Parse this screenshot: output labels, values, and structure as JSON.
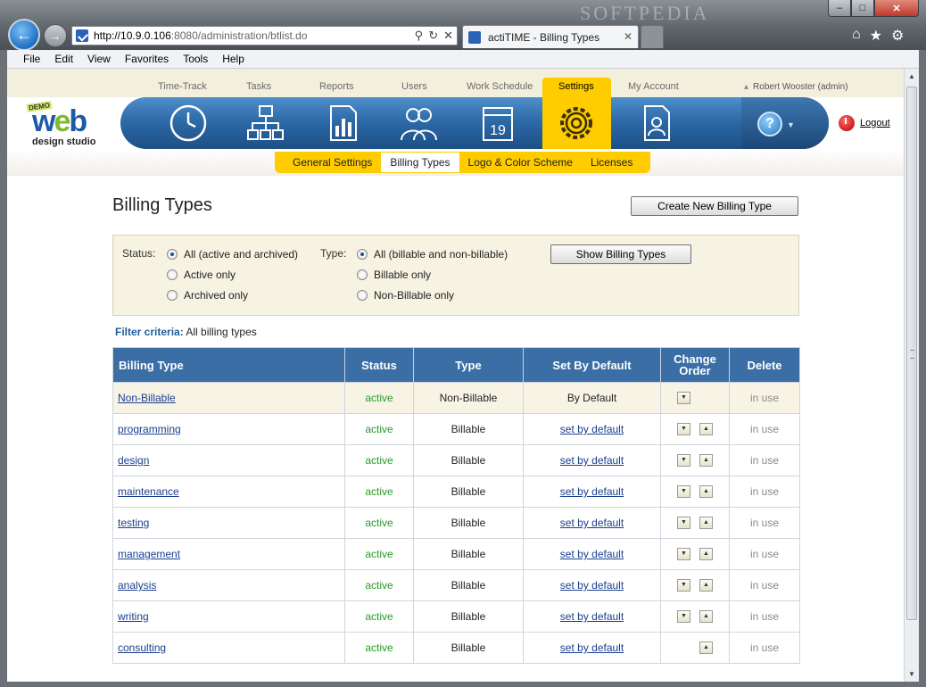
{
  "browser": {
    "url_host": "http://10.9.0.106",
    "url_rest": ":8080/administration/btlist.do",
    "tab_title": "actiTIME - Billing Types",
    "watermark": "SOFTPEDIA",
    "menu": [
      "File",
      "Edit",
      "View",
      "Favorites",
      "Tools",
      "Help"
    ]
  },
  "app": {
    "nav": [
      "Time-Track",
      "Tasks",
      "Reports",
      "Users",
      "Work Schedule",
      "Settings",
      "My Account"
    ],
    "user": "Robert Wooster (admin)",
    "logout": "Logout",
    "logo": {
      "demo": "DEMO",
      "web_w": "w",
      "web_e": "e",
      "web_b": "b",
      "sub": "design studio"
    },
    "subtabs": [
      "General Settings",
      "Billing Types",
      "Logo & Color Scheme",
      "Licenses"
    ],
    "help_icon_glyph": "?"
  },
  "page": {
    "title": "Billing Types",
    "create_button": "Create New Billing Type",
    "show_button": "Show Billing Types",
    "status_label": "Status:",
    "type_label": "Type:",
    "status_options": [
      "All (active and archived)",
      "Active only",
      "Archived only"
    ],
    "type_options": [
      "All (billable and non-billable)",
      "Billable only",
      "Non-Billable only"
    ],
    "criteria_label": "Filter criteria:",
    "criteria_value": "All billing types"
  },
  "table": {
    "headers": [
      "Billing Type",
      "Status",
      "Type",
      "Set By Default",
      "Change Order",
      "Delete"
    ],
    "rows": [
      {
        "name": "Non-Billable",
        "status": "active",
        "type": "Non-Billable",
        "default": "By Default",
        "delete": "in use"
      },
      {
        "name": "programming",
        "status": "active",
        "type": "Billable",
        "default": "set by default",
        "delete": "in use"
      },
      {
        "name": "design",
        "status": "active",
        "type": "Billable",
        "default": "set by default",
        "delete": "in use"
      },
      {
        "name": "maintenance",
        "status": "active",
        "type": "Billable",
        "default": "set by default",
        "delete": "in use"
      },
      {
        "name": "testing",
        "status": "active",
        "type": "Billable",
        "default": "set by default",
        "delete": "in use"
      },
      {
        "name": "management",
        "status": "active",
        "type": "Billable",
        "default": "set by default",
        "delete": "in use"
      },
      {
        "name": "analysis",
        "status": "active",
        "type": "Billable",
        "default": "set by default",
        "delete": "in use"
      },
      {
        "name": "writing",
        "status": "active",
        "type": "Billable",
        "default": "set by default",
        "delete": "in use"
      },
      {
        "name": "consulting",
        "status": "active",
        "type": "Billable",
        "default": "set by default",
        "delete": "in use"
      }
    ]
  },
  "colors": {
    "accent": "#ffcc00",
    "header_blue": "#3a6ea5",
    "active_green": "#2a9a28"
  }
}
